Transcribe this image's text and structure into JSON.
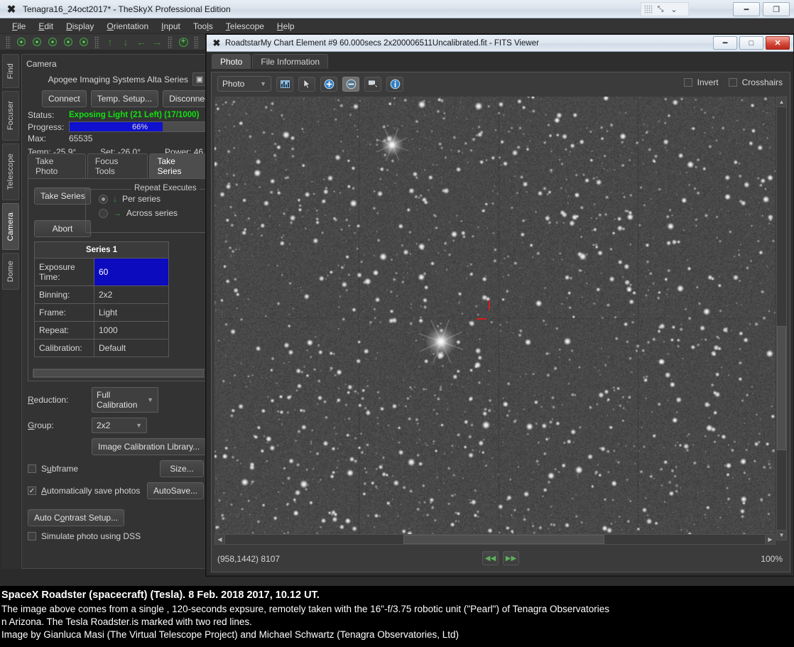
{
  "app_window": {
    "title": "Tenagra16_24oct2017* - TheSkyX Professional Edition",
    "app_icon": "x-logo-icon",
    "menus": [
      "File",
      "Edit",
      "Display",
      "Orientation",
      "Input",
      "Tools",
      "Telescope",
      "Help"
    ],
    "controls": {
      "minimize": "—",
      "restore": "❐",
      "expand": "⤡",
      "chevron": "⌄"
    },
    "toolbar_icons": [
      "green-circle-icon-1",
      "green-circle-icon-2",
      "green-circle-icon-3",
      "green-circle-icon-4",
      "green-circle-icon-5",
      "arrow-up-icon",
      "arrow-down-icon",
      "arrow-left-icon",
      "arrow-right-icon",
      "zoom-in-icon"
    ]
  },
  "sidebar": {
    "items": [
      {
        "label": "Find",
        "active": false
      },
      {
        "label": "Focuser",
        "active": false
      },
      {
        "label": "Telescope",
        "active": false
      },
      {
        "label": "Camera",
        "active": true
      },
      {
        "label": "Dome",
        "active": false
      }
    ]
  },
  "camera_panel": {
    "heading": "Camera",
    "device_name": "Apogee Imaging Systems Alta Series",
    "buttons": {
      "connect": "Connect",
      "temp_setup": "Temp. Setup...",
      "disconnect": "Disconnect"
    },
    "status_label": "Status:",
    "status_value": "Exposing Light (21 Left) (17/1000)",
    "status_color": "#12e012",
    "progress_label": "Progress:",
    "progress_value": "66%",
    "progress_percent": 66,
    "progress_color": "#1010cf",
    "max_label": "Max:",
    "max_value": "65535",
    "temp_label": "Temp: -25.9°",
    "set_label": "Set: -26.0°",
    "power_label": "Power: 46",
    "tabs": [
      {
        "label": "Take Photo",
        "active": false
      },
      {
        "label": "Focus Tools",
        "active": false
      },
      {
        "label": "Take Series",
        "active": true
      }
    ],
    "take_series_button": "Take Series",
    "abort_button": "Abort",
    "repeat_group_title": "Repeat Executes",
    "repeat_options": [
      {
        "label": "Per series",
        "selected": true,
        "arrow": "↓"
      },
      {
        "label": "Across series",
        "selected": false,
        "arrow": "→"
      }
    ],
    "series_table": {
      "header": "Series 1",
      "rows": [
        {
          "key": "Exposure Time:",
          "value": "60",
          "selected": true
        },
        {
          "key": "Binning:",
          "value": "2x2",
          "selected": false
        },
        {
          "key": "Frame:",
          "value": "Light",
          "selected": false
        },
        {
          "key": "Repeat:",
          "value": "1000",
          "selected": false
        },
        {
          "key": "Calibration:",
          "value": "Default",
          "selected": false
        }
      ]
    },
    "reduction_label": "Reduction:",
    "reduction_value": "Full Calibration",
    "group_label": "Group:",
    "group_value": "2x2",
    "image_calibration_button": "Image Calibration Library...",
    "subframe_label": "Subframe",
    "subframe_checked": false,
    "size_button": "Size...",
    "autosave_label": "Automatically save photos",
    "autosave_checked": true,
    "autosave_button": "AutoSave...",
    "auto_contrast_button": "Auto Contrast Setup...",
    "simulate_label": "Simulate photo using DSS",
    "simulate_checked": false
  },
  "fits_viewer": {
    "title": "RoadtstarMy Chart Element #9 60.000secs 2x200006511Uncalibrated.fit - FITS Viewer",
    "app_icon": "x-logo-icon",
    "controls": {
      "minimize": "—",
      "maximize": "□",
      "close": "✕"
    },
    "tabs": [
      {
        "label": "Photo",
        "active": true
      },
      {
        "label": "File Information",
        "active": false
      }
    ],
    "toolbar": {
      "mode_select": "Photo",
      "buttons": [
        {
          "name": "histogram-icon",
          "active": false
        },
        {
          "name": "pointer-icon",
          "active": false
        },
        {
          "name": "zoom-in-icon",
          "active": false
        },
        {
          "name": "zoom-out-icon",
          "active": true
        },
        {
          "name": "pan-icon",
          "active": false
        },
        {
          "name": "info-icon",
          "active": false
        }
      ]
    },
    "invert_label": "Invert",
    "invert_checked": false,
    "crosshairs_label": "Crosshairs",
    "crosshairs_checked": false,
    "status_coordinates": "(958,1442) 8107",
    "zoom_level": "100%",
    "nav_prev": "◀◀",
    "nav_next": "▶▶"
  },
  "caption": {
    "title": "SpaceX Roadster (spacecraft) (Tesla). 8 Feb. 2018 2017, 10.12 UT.",
    "line1": "The image above comes from a single , 120-seconds expsure, remotely taken with the 16\"-f/3.75 robotic unit (\"Pearl\") of Tenagra Observatories",
    "line2": "n Arizona. The Tesla Roadster.is marked with two red lines.",
    "line3": "Image by Gianluca Masi (The Virtual Telescope Project) and Michael Schwartz (Tenagra Observatories, Ltd)"
  }
}
